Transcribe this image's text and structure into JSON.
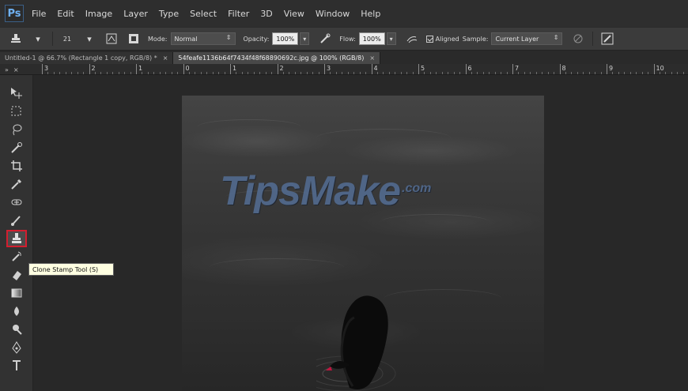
{
  "app": {
    "logo_text": "Ps"
  },
  "menubar": {
    "items": [
      "File",
      "Edit",
      "Image",
      "Layer",
      "Type",
      "Select",
      "Filter",
      "3D",
      "View",
      "Window",
      "Help"
    ]
  },
  "options": {
    "brush_size": "21",
    "mode_label": "Mode:",
    "mode_value": "Normal",
    "opacity_label": "Opacity:",
    "opacity_value": "100%",
    "flow_label": "Flow:",
    "flow_value": "100%",
    "aligned_label": "Aligned",
    "sample_label": "Sample:",
    "sample_value": "Current Layer"
  },
  "tabs": [
    {
      "label": "Untitled-1 @ 66.7% (Rectangle 1 copy, RGB/8) *",
      "close": "×"
    },
    {
      "label": "54feafe1136b64f7434f48f68890692c.jpg @ 100% (RGB/8)",
      "close": "×"
    }
  ],
  "panel": {
    "collapse_label": "»",
    "close_label": "×"
  },
  "ruler": {
    "numbers": [
      "3",
      "2",
      "1",
      "0",
      "1",
      "2",
      "3",
      "4",
      "5",
      "6",
      "7",
      "8",
      "9",
      "10"
    ]
  },
  "toolbar": {
    "tools": [
      "move-tool",
      "marquee-tool",
      "lasso-tool",
      "quick-selection-tool",
      "crop-tool",
      "eyedropper-tool",
      "spot-healing-tool",
      "brush-tool",
      "clone-stamp-tool",
      "history-brush-tool",
      "eraser-tool",
      "gradient-tool",
      "blur-tool",
      "dodge-tool",
      "pen-tool",
      "type-tool"
    ],
    "selected_tool": "clone-stamp-tool"
  },
  "tooltip": {
    "text": "Clone Stamp Tool (S)"
  },
  "document": {
    "watermark_text": "TipsMake",
    "watermark_suffix": ".com"
  },
  "colors": {
    "accent_red": "#d21e2f",
    "ps_blue": "#6fb1f2",
    "watermark_blue": "#536d93"
  }
}
